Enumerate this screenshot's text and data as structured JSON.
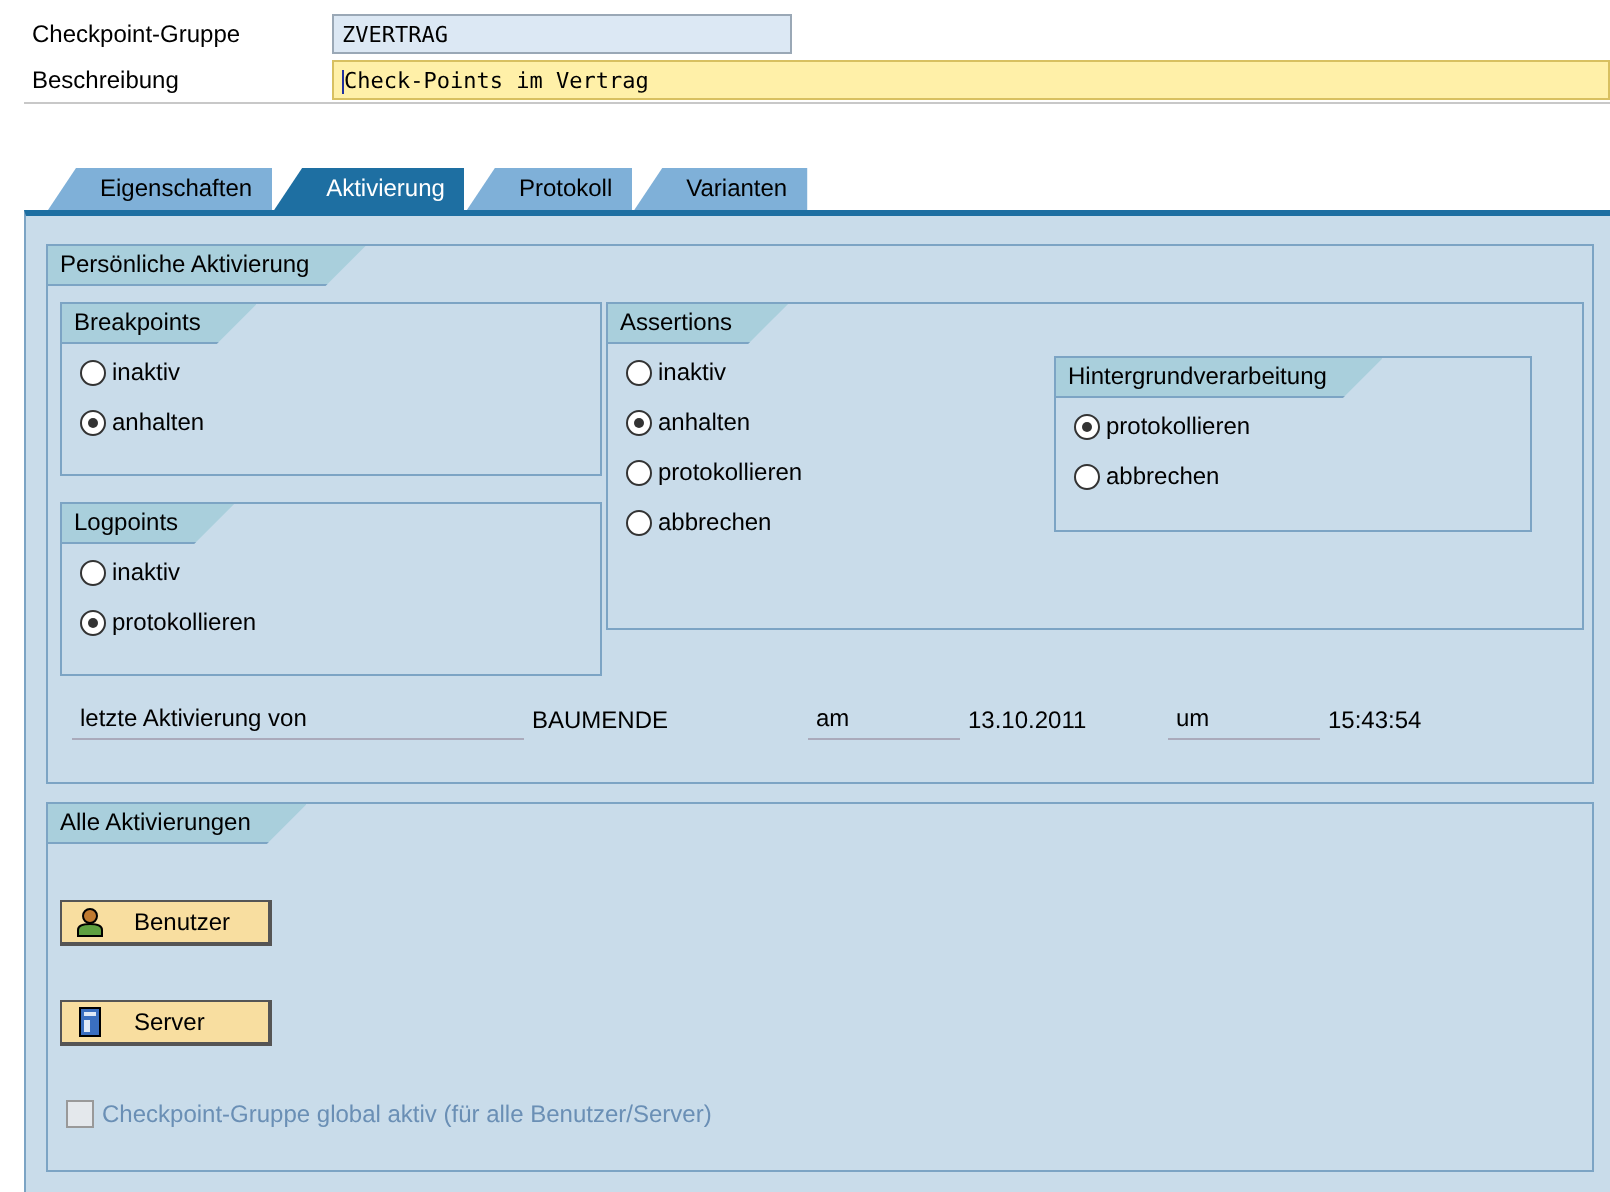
{
  "header": [
    {
      "label": "Checkpoint-Gruppe",
      "value": "ZVERTRAG",
      "kind": "readonly"
    },
    {
      "label": "Beschreibung",
      "value": "Check-Points im Vertrag",
      "kind": "editable"
    }
  ],
  "tabs": [
    {
      "label": "Eigenschaften",
      "selected": false
    },
    {
      "label": "Aktivierung",
      "selected": true
    },
    {
      "label": "Protokoll",
      "selected": false
    },
    {
      "label": "Varianten",
      "selected": false
    }
  ],
  "personal": {
    "title": "Persönliche Aktivierung",
    "breakpoints": {
      "title": "Breakpoints",
      "options": [
        {
          "label": "inaktiv",
          "selected": false
        },
        {
          "label": "anhalten",
          "selected": true
        }
      ]
    },
    "logpoints": {
      "title": "Logpoints",
      "options": [
        {
          "label": "inaktiv",
          "selected": false
        },
        {
          "label": "protokollieren",
          "selected": true
        }
      ]
    },
    "assertions": {
      "title": "Assertions",
      "options": [
        {
          "label": "inaktiv",
          "selected": false
        },
        {
          "label": "anhalten",
          "selected": true
        },
        {
          "label": "protokollieren",
          "selected": false
        },
        {
          "label": "abbrechen",
          "selected": false
        }
      ]
    },
    "background": {
      "title": "Hintergrundverarbeitung",
      "options": [
        {
          "label": "protokollieren",
          "selected": true
        },
        {
          "label": "abbrechen",
          "selected": false
        }
      ]
    },
    "last_activation": {
      "label": "letzte Aktivierung von",
      "user": "BAUMENDE",
      "date_label": "am",
      "date": "13.10.2011",
      "time_label": "um",
      "time": "15:43:54"
    }
  },
  "all": {
    "title": "Alle Aktivierungen",
    "buttons": [
      {
        "label": "Benutzer",
        "kind": "user"
      },
      {
        "label": "Server",
        "kind": "server"
      }
    ],
    "checkbox": {
      "label": "Checkpoint-Gruppe global aktiv (für alle Benutzer/Server)",
      "checked": false,
      "disabled": true
    }
  }
}
